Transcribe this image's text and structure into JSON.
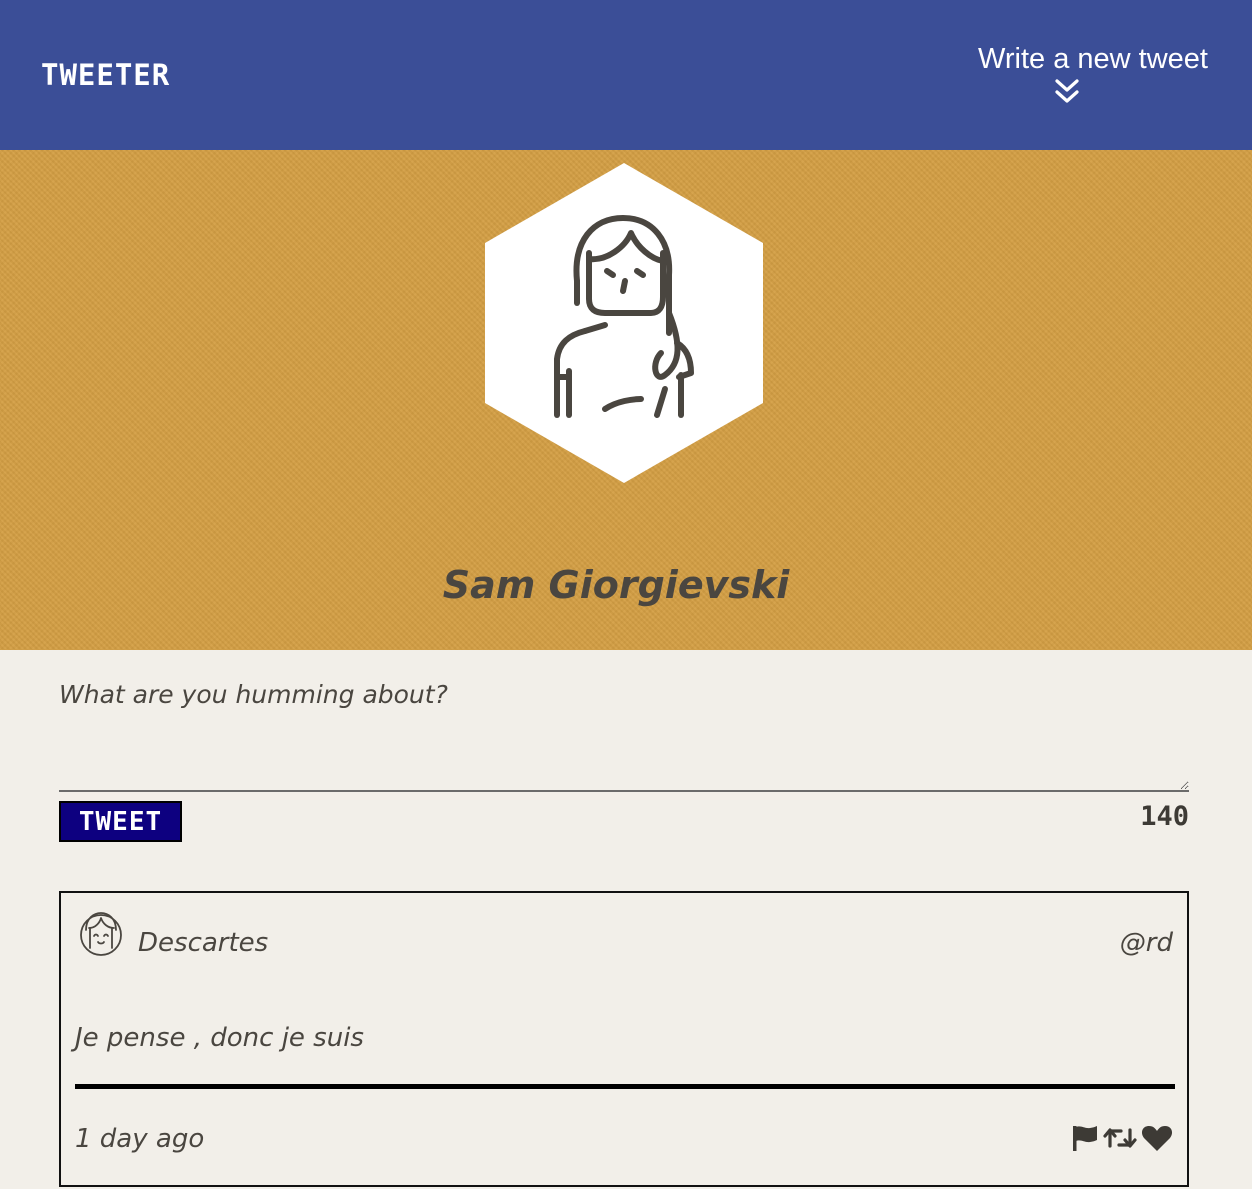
{
  "nav": {
    "brand": "TWEETER",
    "compose_toggle_label": "Write a new tweet",
    "compose_toggle_icon": "double-chevron-down-icon"
  },
  "profile": {
    "name": "Sam Giorgievski",
    "avatar_icon": "user-avatar-icon",
    "banner_color": "#d49f44"
  },
  "compose": {
    "placeholder": "What are you humming about?",
    "value": "",
    "submit_label": "TWEET",
    "char_counter": "140"
  },
  "tweets": [
    {
      "author": "Descartes",
      "handle": "@rd",
      "content": "Je pense , donc je suis",
      "timestamp": "1 day ago",
      "avatar_icon": "user-avatar-icon",
      "actions": [
        "flag-icon",
        "retweet-icon",
        "heart-icon"
      ]
    }
  ],
  "colors": {
    "nav_bg": "#3b4e97",
    "page_bg": "#f2efe9",
    "button_bg": "#0d0080",
    "text": "#4a4640"
  }
}
